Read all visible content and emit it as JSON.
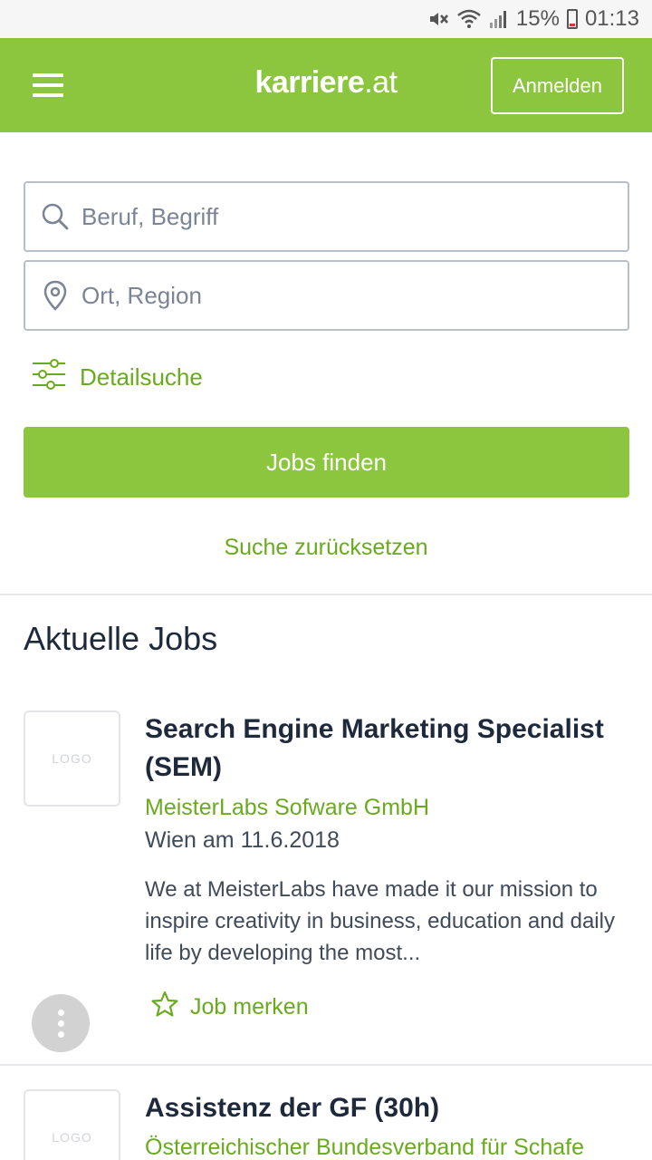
{
  "status_bar": {
    "battery": "15%",
    "time": "01:13",
    "icons": [
      "mute-icon",
      "wifi-icon",
      "signal-icon",
      "battery-icon"
    ]
  },
  "header": {
    "brand_main": "karriere",
    "brand_suffix": ".at",
    "login_label": "Anmelden",
    "color": "#8cc63e"
  },
  "search": {
    "job_placeholder": "Beruf, Begriff",
    "location_placeholder": "Ort, Region",
    "detail_label": "Detailsuche",
    "find_label": "Jobs finden",
    "reset_label": "Suche zurücksetzen"
  },
  "jobs": {
    "section_title": "Aktuelle Jobs",
    "items": [
      {
        "logo_text": "LOGO",
        "title": "Search Engine Marketing Specialist (SEM)",
        "company": "MeisterLabs Sofware GmbH",
        "location_date": "Wien am 11.6.2018",
        "description": "We at MeisterLabs have made it our mission to inspire creativity in business, education and daily life by developing the most...",
        "save_label": "Job merken"
      },
      {
        "logo_text": "LOGO",
        "title": "Assistenz der GF (30h)",
        "company": "Österreichischer Bundesverband für Schafe"
      }
    ]
  },
  "colors": {
    "accent": "#8cc63e",
    "link": "#6aaa1e",
    "text": "#1e2a3b"
  }
}
